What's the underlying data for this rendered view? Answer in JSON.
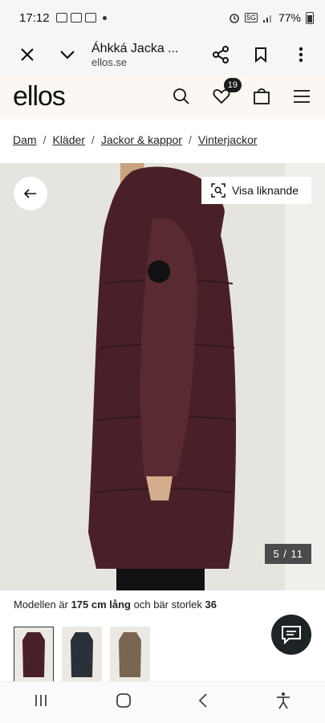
{
  "status_bar": {
    "time": "17:12",
    "battery": "77%",
    "network": "5G"
  },
  "browser": {
    "title": "Áhkká Jacka ...",
    "url": "ellos.se",
    "icons": [
      "close-icon",
      "chevron-down-icon",
      "share-icon",
      "bookmark-icon",
      "more-icon"
    ]
  },
  "header": {
    "logo": "ellos",
    "wishlist_count": "19",
    "icons": [
      "search-icon",
      "heart-icon",
      "bag-icon",
      "menu-icon"
    ]
  },
  "breadcrumb": [
    {
      "label": "Dam"
    },
    {
      "label": "Kläder"
    },
    {
      "label": "Jackor & kappor"
    },
    {
      "label": "Vinterjackor"
    }
  ],
  "separator": "/",
  "gallery": {
    "similar_label": "Visa liknande",
    "counter": "5 / 11",
    "colors": {
      "coat": "#4a2028",
      "background": "#e6e4df"
    }
  },
  "model": {
    "prefix": "Modellen är",
    "height": "175 cm lång",
    "middle": "och bär storlek",
    "size": "36"
  },
  "thumbnails": [
    {
      "color": "#4a2028"
    },
    {
      "color": "#2a3038"
    },
    {
      "color": "#7a6452"
    }
  ]
}
